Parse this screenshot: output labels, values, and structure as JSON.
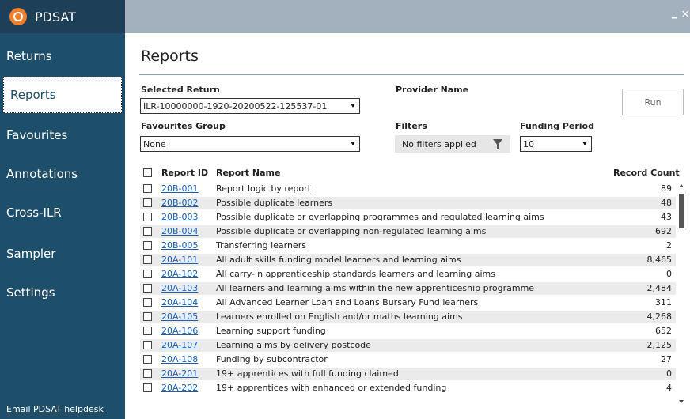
{
  "app": {
    "title": "PDSAT",
    "logo_icon": "target-icon"
  },
  "window": {
    "minimize": "–",
    "close": "×"
  },
  "sidebar": {
    "items": [
      {
        "label": "Returns"
      },
      {
        "label": "Reports"
      },
      {
        "label": "Favourites"
      },
      {
        "label": "Annotations"
      },
      {
        "label": "Cross-ILR"
      },
      {
        "label": "Sampler"
      },
      {
        "label": "Settings"
      }
    ],
    "active": "Reports",
    "helpdesk": "Email PDSAT helpdesk"
  },
  "page": {
    "title": "Reports"
  },
  "form": {
    "selected_return_label": "Selected Return",
    "selected_return_value": "ILR-10000000-1920-20200522-125537-01",
    "provider_name_label": "Provider Name",
    "favourites_group_label": "Favourites Group",
    "favourites_group_value": "None",
    "filters_label": "Filters",
    "filters_value": "No filters applied",
    "funding_period_label": "Funding Period",
    "funding_period_value": "10",
    "run_label": "Run"
  },
  "table": {
    "headers": {
      "report_id": "Report ID",
      "report_name": "Report Name",
      "record_count": "Record Count"
    },
    "rows": [
      {
        "id": "20B-001",
        "name": "Report logic by report",
        "count": "89"
      },
      {
        "id": "20B-002",
        "name": "Possible duplicate learners",
        "count": "48"
      },
      {
        "id": "20B-003",
        "name": "Possible duplicate or overlapping programmes and regulated learning aims",
        "count": "43"
      },
      {
        "id": "20B-004",
        "name": "Possible duplicate or overlapping non-regulated learning aims",
        "count": "692"
      },
      {
        "id": "20B-005",
        "name": "Transferring learners",
        "count": "2"
      },
      {
        "id": "20A-101",
        "name": "All adult skills funding model learners and learning aims",
        "count": "8,465"
      },
      {
        "id": "20A-102",
        "name": "All carry-in apprenticeship standards learners and learning aims",
        "count": "0"
      },
      {
        "id": "20A-103",
        "name": "All learners and learning aims within the new apprenticeship programme",
        "count": "2,484"
      },
      {
        "id": "20A-104",
        "name": "All Advanced Learner Loan and Loans Bursary Fund learners",
        "count": "311"
      },
      {
        "id": "20A-105",
        "name": "Learners enrolled on English and/or maths learning aims",
        "count": "4,268"
      },
      {
        "id": "20A-106",
        "name": "Learning support funding",
        "count": "652"
      },
      {
        "id": "20A-107",
        "name": "Learning aims by delivery postcode",
        "count": "2,125"
      },
      {
        "id": "20A-108",
        "name": "Funding by subcontractor",
        "count": "27"
      },
      {
        "id": "20A-201",
        "name": "19+ apprentices with full funding claimed",
        "count": "0"
      },
      {
        "id": "20A-202",
        "name": "19+ apprentices with enhanced or extended funding",
        "count": "4"
      }
    ]
  },
  "colors": {
    "sidebar_bg": "#1e4f6a",
    "titlebar_bg": "#a2b1bd",
    "link": "#1a5fb4",
    "logo": "#f07e2b"
  }
}
